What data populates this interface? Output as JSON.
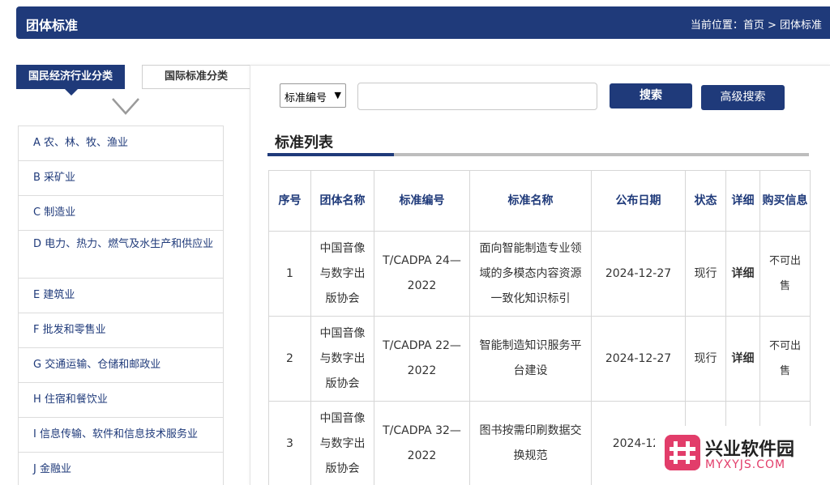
{
  "header": {
    "title": "团体标准",
    "breadcrumb": "当前位置：首页 > 团体标准"
  },
  "category_tabs": [
    {
      "label": "国民经济行业分类",
      "active": true
    },
    {
      "label": "国际标准分类",
      "active": false
    }
  ],
  "category_toggle_icon": "chevron-down-icon",
  "categories": [
    "A 农、林、牧、渔业",
    "B 采矿业",
    "C 制造业",
    "D 电力、热力、燃气及水生产和供应业",
    "E 建筑业",
    "F 批发和零售业",
    "G 交通运输、仓储和邮政业",
    "H 住宿和餐饮业",
    "I 信息传输、软件和信息技术服务业",
    "J 金融业"
  ],
  "search": {
    "select_value": "标准编号",
    "input_value": "",
    "search_label": "搜索",
    "advanced_label": "高级搜索"
  },
  "list": {
    "title": "标准列表",
    "columns": [
      "序号",
      "团体名称",
      "标准编号",
      "标准名称",
      "公布日期",
      "状态",
      "详细",
      "购买信息"
    ],
    "rows": [
      {
        "no": "1",
        "org": "中国音像与数字出版协会",
        "code": "T/CADPA 24—2022",
        "name": "面向智能制造专业领域的多模态内容资源一致化知识标引",
        "date": "2024-12-27",
        "status": "现行",
        "detail": "详细",
        "buy": "不可出售"
      },
      {
        "no": "2",
        "org": "中国音像与数字出版协会",
        "code": "T/CADPA 22—2022",
        "name": "智能制造知识服务平台建设",
        "date": "2024-12-27",
        "status": "现行",
        "detail": "详细",
        "buy": "不可出售"
      },
      {
        "no": "3",
        "org": "中国音像与数字出版协会",
        "code": "T/CADPA 32—2022",
        "name": "图书按需印刷数据交换规范",
        "date": "2024-12-",
        "status": "",
        "detail": "",
        "buy": ""
      }
    ]
  },
  "watermark": {
    "text": "兴业软件园",
    "sub": "MYXYJS.COM",
    "logo_icon": "watermark-logo-icon"
  },
  "colors": {
    "primary": "#1f3a7a",
    "border": "#d6d6d6",
    "muted": "#aaaaaa",
    "watermark": "#e23d6a"
  }
}
